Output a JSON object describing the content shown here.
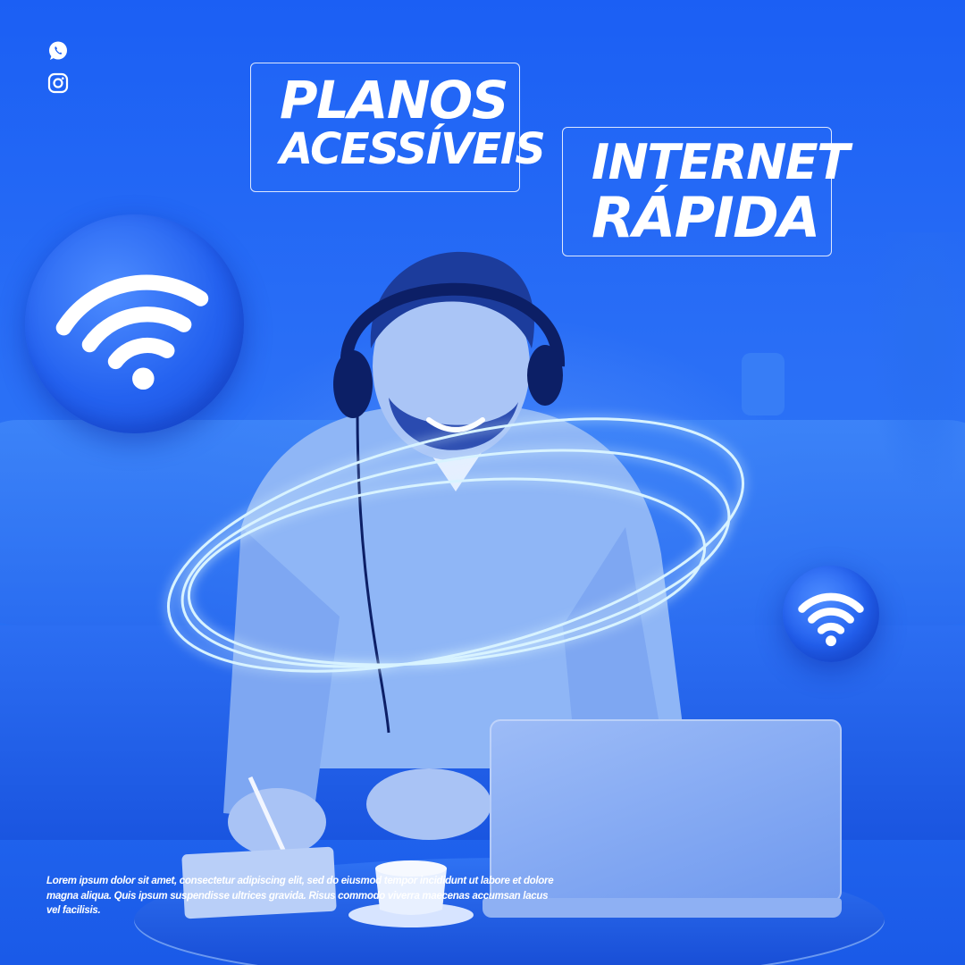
{
  "icons": {
    "whatsapp": "whatsapp-icon",
    "instagram": "instagram-icon",
    "wifi": "wifi-icon"
  },
  "headline_left": {
    "line1": "PLANOS",
    "line2": "ACESSÍVEIS"
  },
  "headline_right": {
    "line1": "INTERNET",
    "line2": "RÁPIDA"
  },
  "body_text": "Lorem ipsum dolor sit amet, consectetur adipiscing elit, sed do eiusmod tempor incididunt ut labore et dolore magna aliqua. Quis ipsum suspendisse ultrices gravida. Risus commodo viverra maecenas accumsan lacus vel facilisis.",
  "colors": {
    "background": "#1b5ff4",
    "text": "#ffffff",
    "ring_glow": "#bfe6ff"
  }
}
